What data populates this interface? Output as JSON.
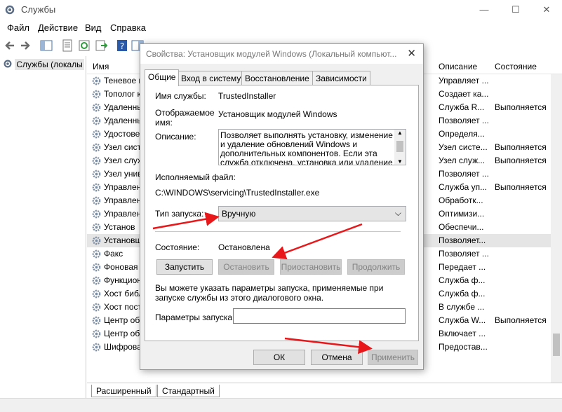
{
  "window": {
    "title": "Службы",
    "controls": [
      "—",
      "☐",
      "✕"
    ]
  },
  "menu": [
    "Файл",
    "Действие",
    "Вид",
    "Справка"
  ],
  "tree": {
    "root_label": "Службы (локалы"
  },
  "columns": {
    "name": "Имя",
    "description": "Описание",
    "status": "Состояние"
  },
  "rows": [
    {
      "name": "Теневое к",
      "desc": "Управляет ...",
      "status": ""
    },
    {
      "name": "Тополог к",
      "desc": "Создает ка...",
      "status": ""
    },
    {
      "name": "Удаленны",
      "desc": "Служба R...",
      "status": "Выполняется"
    },
    {
      "name": "Удаленны",
      "desc": "Позволяет ...",
      "status": ""
    },
    {
      "name": "Удостове",
      "desc": "Определя...",
      "status": ""
    },
    {
      "name": "Узел сист",
      "desc": "Узел систе...",
      "status": "Выполняется"
    },
    {
      "name": "Узел служ",
      "desc": "Узел служ...",
      "status": "Выполняется"
    },
    {
      "name": "Узел унив",
      "desc": "Позволяет ...",
      "status": ""
    },
    {
      "name": "Управлен",
      "desc": "Служба уп...",
      "status": "Выполняется"
    },
    {
      "name": "Управлен",
      "desc": "Обработк...",
      "status": ""
    },
    {
      "name": "Управлен",
      "desc": "Оптимизи...",
      "status": ""
    },
    {
      "name": "Установ",
      "desc": "Обеспечи...",
      "status": ""
    },
    {
      "name": "Установщ",
      "desc": "Позволяет...",
      "status": ""
    },
    {
      "name": "Факс",
      "desc": "Позволяет ...",
      "status": ""
    },
    {
      "name": "Фоновая",
      "desc": "Передает ...",
      "status": ""
    },
    {
      "name": "Функцион",
      "desc": "Служба ф...",
      "status": ""
    },
    {
      "name": "Хост библ",
      "desc": "Служба ф...",
      "status": ""
    },
    {
      "name": "Хост пост",
      "desc": "В службе ...",
      "status": ""
    },
    {
      "name": "Центр об",
      "desc": "Служба W...",
      "status": "Выполняется"
    },
    {
      "name": "Центр об",
      "desc": "Включает ...",
      "status": ""
    },
    {
      "name": "Шифрова",
      "desc": "Предостав...",
      "status": ""
    }
  ],
  "bottom_tabs": [
    "Расширенный",
    "Стандартный"
  ],
  "dialog": {
    "title": "Свойства: Установщик модулей Windows (Локальный компьют...",
    "close": "✕",
    "tabs": [
      "Общие",
      "Вход в систему",
      "Восстановление",
      "Зависимости"
    ],
    "service_name_label": "Имя службы:",
    "service_name": "TrustedInstaller",
    "display_name_label": "Отображаемое\nимя:",
    "display_name": "Установщик модулей Windows",
    "description_label": "Описание:",
    "description": "Позволяет выполнять установку, изменение и удаление обновлений Windows и дополнительных компонентов. Если эта служба отключена, установка или удаление обновлений",
    "exe_label": "Исполняемый файл:",
    "exe_path": "C:\\WINDOWS\\servicing\\TrustedInstaller.exe",
    "startup_label": "Тип запуска:",
    "startup_value": "Вручную",
    "state_label": "Состояние:",
    "state_value": "Остановлена",
    "btn_start": "Запустить",
    "btn_stop": "Остановить",
    "btn_pause": "Приостановить",
    "btn_resume": "Продолжить",
    "hint": "Вы можете указать параметры запуска, применяемые при запуске службы из этого диалогового окна.",
    "params_label": "Параметры запуска:",
    "params_value": "",
    "ok": "ОК",
    "cancel": "Отмена",
    "apply": "Применить"
  },
  "colors": {
    "accent_arrow": "#e8171a",
    "selection": "#e5e5e5",
    "dialog_bg": "#f0f0f0"
  }
}
